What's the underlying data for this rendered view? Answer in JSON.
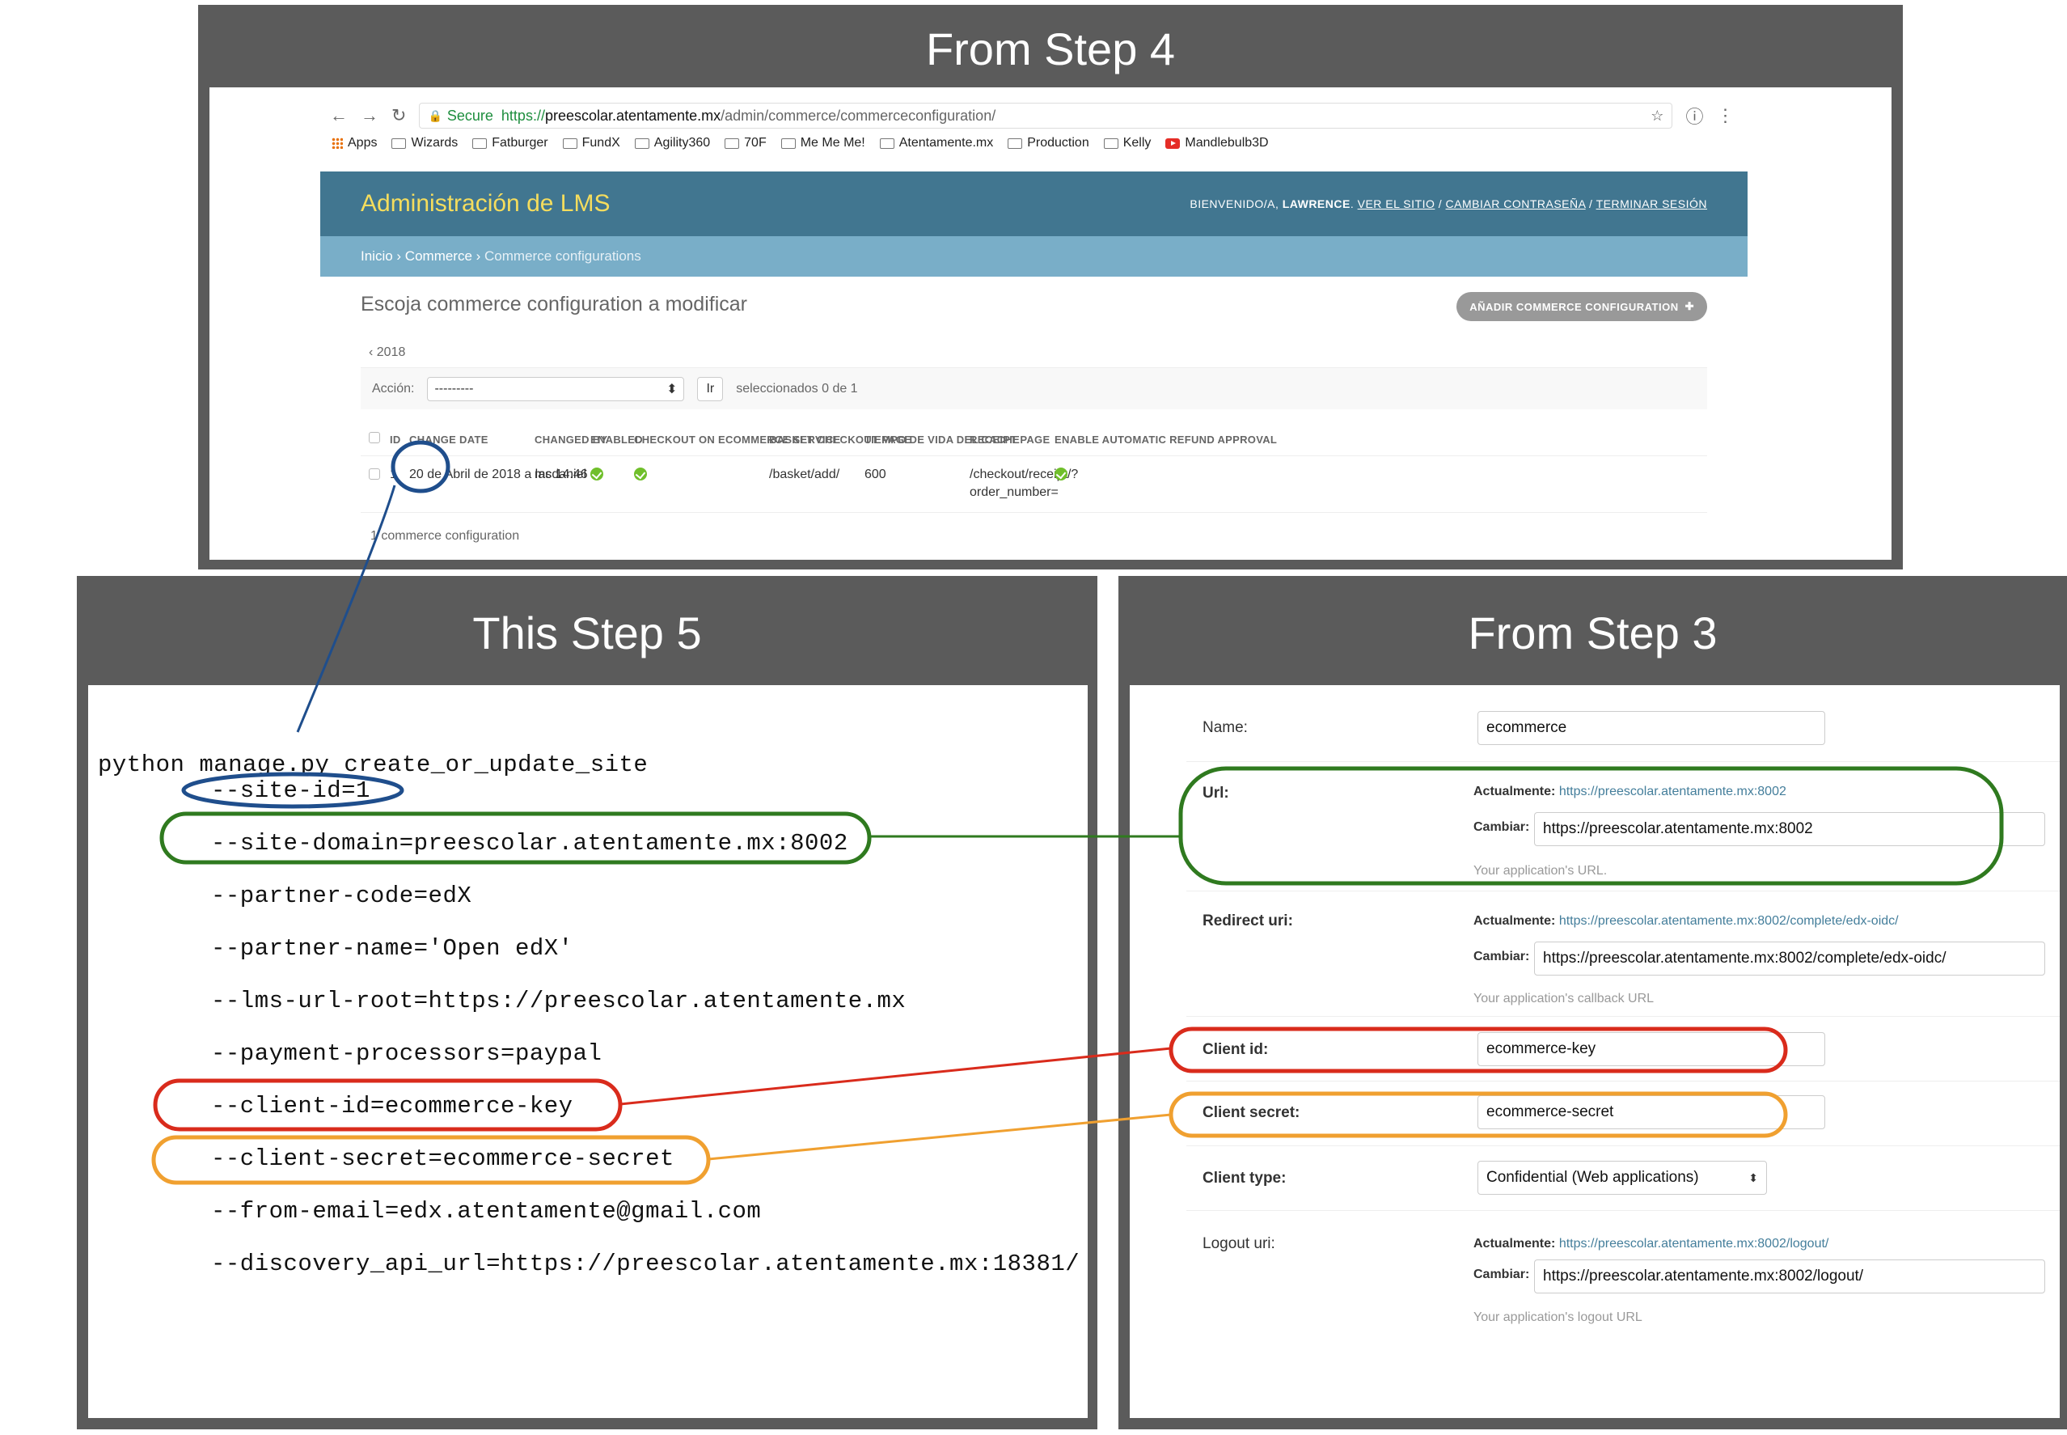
{
  "step4": {
    "title": "From Step 4",
    "browser": {
      "secure_label": "Secure",
      "url_scheme": "https://",
      "url_host": "preescolar.atentamente.mx",
      "url_path": "/admin/commerce/commerceconfiguration/",
      "bookmarks": [
        "Apps",
        "Wizards",
        "Fatburger",
        "FundX",
        "Agility360",
        "70F",
        "Me Me Me!",
        "Atentamente.mx",
        "Production",
        "Kelly",
        "Mandlebulb3D"
      ]
    },
    "admin": {
      "brand": "Administración de LMS",
      "welcome": "BIENVENIDO/A,",
      "username": "LAWRENCE",
      "view_site": "VER EL SITIO",
      "change_password": "CAMBIAR CONTRASEÑA",
      "logout": "TERMINAR SESIÓN",
      "breadcrumb_home": "Inicio",
      "breadcrumb_app": "Commerce",
      "breadcrumb_current": "Commerce configurations",
      "content_title": "Escoja commerce configuration a modificar",
      "add_button": "AÑADIR COMMERCE CONFIGURATION",
      "date_hierarchy": "‹ 2018",
      "action_label": "Acción:",
      "action_select": "---------",
      "go_button": "Ir",
      "selection_counter": "seleccionados 0 de 1",
      "columns": [
        "ID",
        "CHANGE DATE",
        "CHANGED BY",
        "ENABLED",
        "CHECKOUT ON ECOMMERCE SERVICE",
        "BASKET CHECKOUT PAGE",
        "TIEMPO DE VIDA DEL CACHE",
        "RECEIPT PAGE",
        "ENABLE AUTOMATIC REFUND APPROVAL"
      ],
      "row": {
        "id": "1",
        "change_date": "20 de Abril de 2018 a las 14:46",
        "changed_by": "mcdaniel",
        "basket_checkout_page": "/basket/add/",
        "cache_ttl": "600",
        "receipt_page_1": "/checkout/receipt/?",
        "receipt_page_2": "order_number="
      },
      "paginator": "1 commerce configuration"
    }
  },
  "step5": {
    "title": "This Step 5",
    "lines": [
      "python manage.py create_or_update_site",
      "--site-id=1",
      "--site-domain=preescolar.atentamente.mx:8002",
      "--partner-code=edX",
      "--partner-name='Open edX'",
      "--lms-url-root=https://preescolar.atentamente.mx",
      "--payment-processors=paypal",
      "--client-id=ecommerce-key",
      "--client-secret=ecommerce-secret",
      "--from-email=edx.atentamente@gmail.com",
      "--discovery_api_url=https://preescolar.atentamente.mx:18381/"
    ]
  },
  "step3": {
    "title": "From Step 3",
    "name_label": "Name:",
    "name_value": "ecommerce",
    "url_label": "Url:",
    "currently_label": "Actualmente:",
    "change_label": "Cambiar:",
    "url_current": "https://preescolar.atentamente.mx:8002",
    "url_value": "https://preescolar.atentamente.mx:8002",
    "url_help": "Your application's URL.",
    "redirect_label": "Redirect uri:",
    "redirect_current": "https://preescolar.atentamente.mx:8002/complete/edx-oidc/",
    "redirect_value": "https://preescolar.atentamente.mx:8002/complete/edx-oidc/",
    "redirect_help": "Your application's callback URL",
    "client_id_label": "Client id:",
    "client_id_value": "ecommerce-key",
    "client_secret_label": "Client secret:",
    "client_secret_value": "ecommerce-secret",
    "client_type_label": "Client type:",
    "client_type_value": "Confidential (Web applications)",
    "logout_label": "Logout uri:",
    "logout_current": "https://preescolar.atentamente.mx:8002/logout/",
    "logout_value": "https://preescolar.atentamente.mx:8002/logout/",
    "logout_help": "Your application's logout URL"
  },
  "annotation_colors": {
    "blue": "#1f4e8c",
    "green": "#2f7a1f",
    "red": "#d92b1c",
    "orange": "#f0a030"
  }
}
